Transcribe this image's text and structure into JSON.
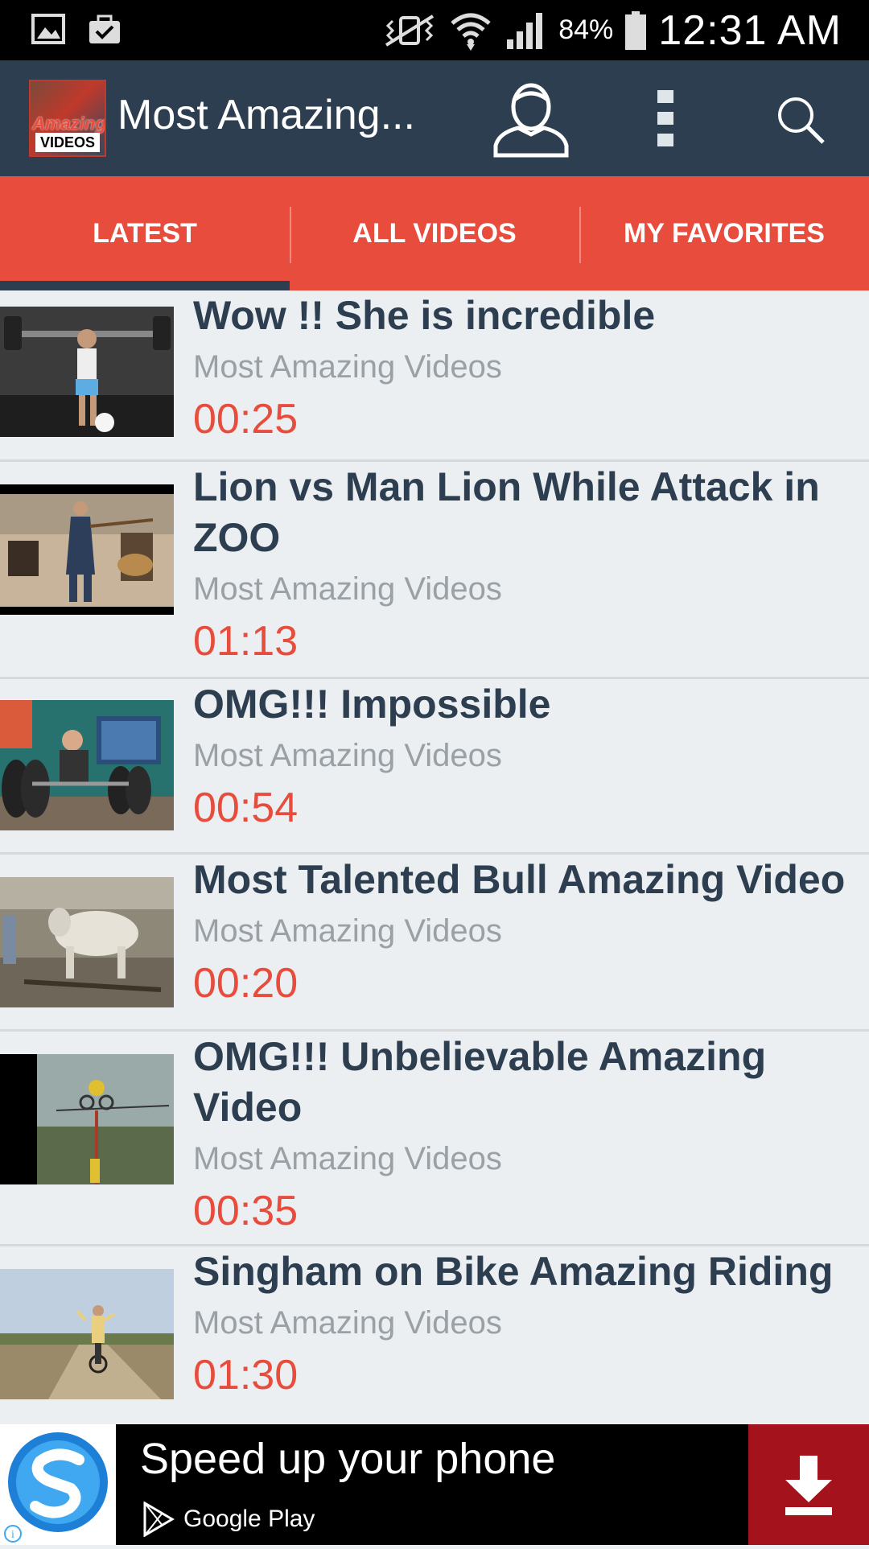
{
  "status_bar": {
    "battery": "84%",
    "time": "12:31 AM",
    "icons": [
      "gallery-icon",
      "briefcase-check-icon",
      "vibrate-silent-icon",
      "wifi-icon",
      "signal-icon",
      "battery-icon"
    ]
  },
  "app_bar": {
    "logo_text_top": "Amazing",
    "logo_text_bottom": "VIDEOS",
    "title": "Most Amazing...",
    "icons": [
      "profile-icon",
      "overflow-menu-icon",
      "search-icon"
    ]
  },
  "tabs": [
    {
      "label": "LATEST",
      "active": true
    },
    {
      "label": "ALL VIDEOS",
      "active": false
    },
    {
      "label": "MY FAVORITES",
      "active": false
    }
  ],
  "videos": [
    {
      "title": "Wow !! She is incredible",
      "channel": "Most Amazing Videos",
      "duration": "00:25"
    },
    {
      "title": "Lion vs Man Lion While Attack in ZOO",
      "channel": "Most Amazing Videos",
      "duration": "01:13"
    },
    {
      "title": "OMG!!! Impossible",
      "channel": "Most Amazing Videos",
      "duration": "00:54"
    },
    {
      "title": "Most Talented Bull Amazing Video",
      "channel": "Most Amazing Videos",
      "duration": "00:20"
    },
    {
      "title": "OMG!!! Unbelievable Amazing Video",
      "channel": "Most Amazing Videos",
      "duration": "00:35"
    },
    {
      "title": "Singham on Bike Amazing Riding",
      "channel": "Most Amazing Videos",
      "duration": "01:30"
    }
  ],
  "ad": {
    "headline": "Speed up your phone",
    "store": "Google Play"
  },
  "colors": {
    "app_bar": "#2c3e50",
    "tabs": "#e74c3c",
    "accent": "#e74c3c",
    "background": "#eceff1",
    "ad_download": "#a4121b"
  }
}
